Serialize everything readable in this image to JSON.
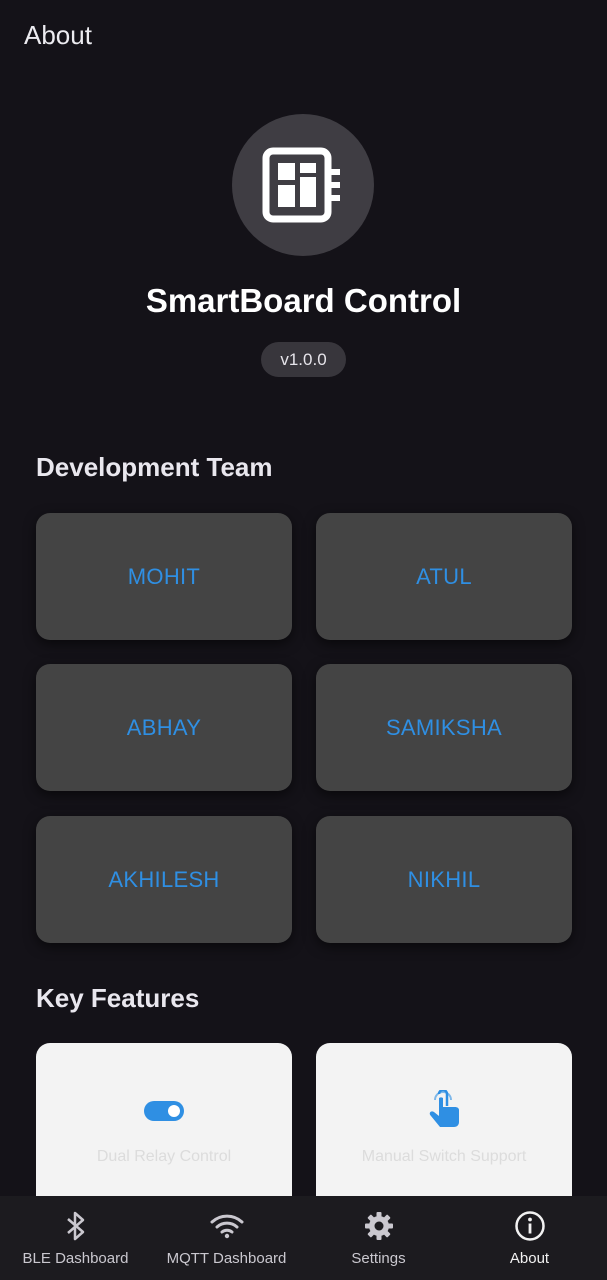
{
  "appbar": {
    "title": "About"
  },
  "app_info": {
    "name": "SmartBoard Control",
    "version": "v1.0.0"
  },
  "team": {
    "title": "Development Team",
    "members": [
      "MOHIT",
      "ATUL",
      "ABHAY",
      "SAMIKSHA",
      "AKHILESH",
      "NIKHIL"
    ]
  },
  "features": {
    "title": "Key Features",
    "items": [
      {
        "label": "Dual Relay Control",
        "icon": "toggle-icon"
      },
      {
        "label": "Manual Switch Support",
        "icon": "touch-icon"
      }
    ]
  },
  "nav": {
    "items": [
      {
        "label": "BLE Dashboard",
        "icon": "bluetooth-icon"
      },
      {
        "label": "MQTT Dashboard",
        "icon": "wifi-icon"
      },
      {
        "label": "Settings",
        "icon": "gear-icon"
      },
      {
        "label": "About",
        "icon": "info-icon"
      }
    ],
    "active": "About"
  },
  "colors": {
    "background": "#141218",
    "card": "#444444",
    "accent": "#2f8fe3",
    "feature_card": "#f3f3f3",
    "nav_bar": "#1c1b1f"
  }
}
